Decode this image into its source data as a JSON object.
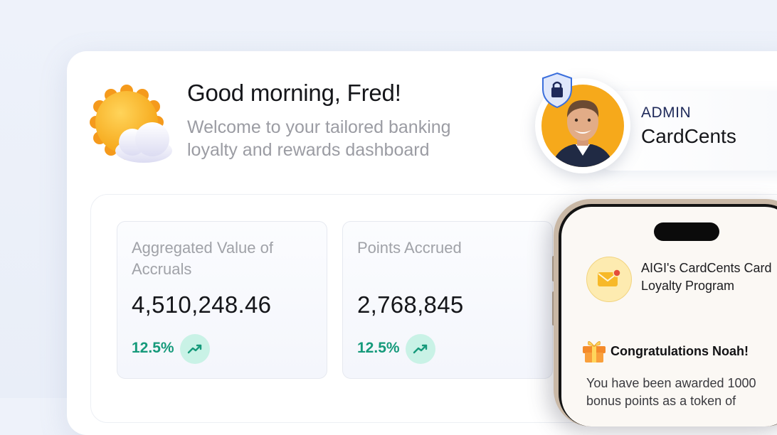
{
  "greeting": {
    "title": "Good morning, Fred!",
    "subtitle": "Welcome to your tailored banking loyalty and rewards dashboard",
    "weather_icon": "sun-cloud-icon"
  },
  "profile": {
    "role": "ADMIN",
    "name": "CardCents",
    "badge_icon": "shield-lock-icon"
  },
  "stats": [
    {
      "label": "Aggregated Value of Accruals",
      "value": "4,510,248.46",
      "change": "12.5%",
      "trend_icon": "trending-up-icon"
    },
    {
      "label": "Points Accrued",
      "value": "2,768,845",
      "change": "12.5%",
      "trend_icon": "trending-up-icon"
    }
  ],
  "phone": {
    "program_icon": "mail-icon",
    "program_title": "AIGI's CardCents Card Loyalty Program",
    "gift_icon": "gift-icon",
    "congrats": "Congratulations Noah!",
    "message": "You have been awarded 1000 bonus points as a token of"
  },
  "colors": {
    "positive": "#169a7b",
    "positive_bg": "#c9f2e6",
    "accent_orange": "#f6a91b",
    "navy": "#1f2a5a"
  }
}
